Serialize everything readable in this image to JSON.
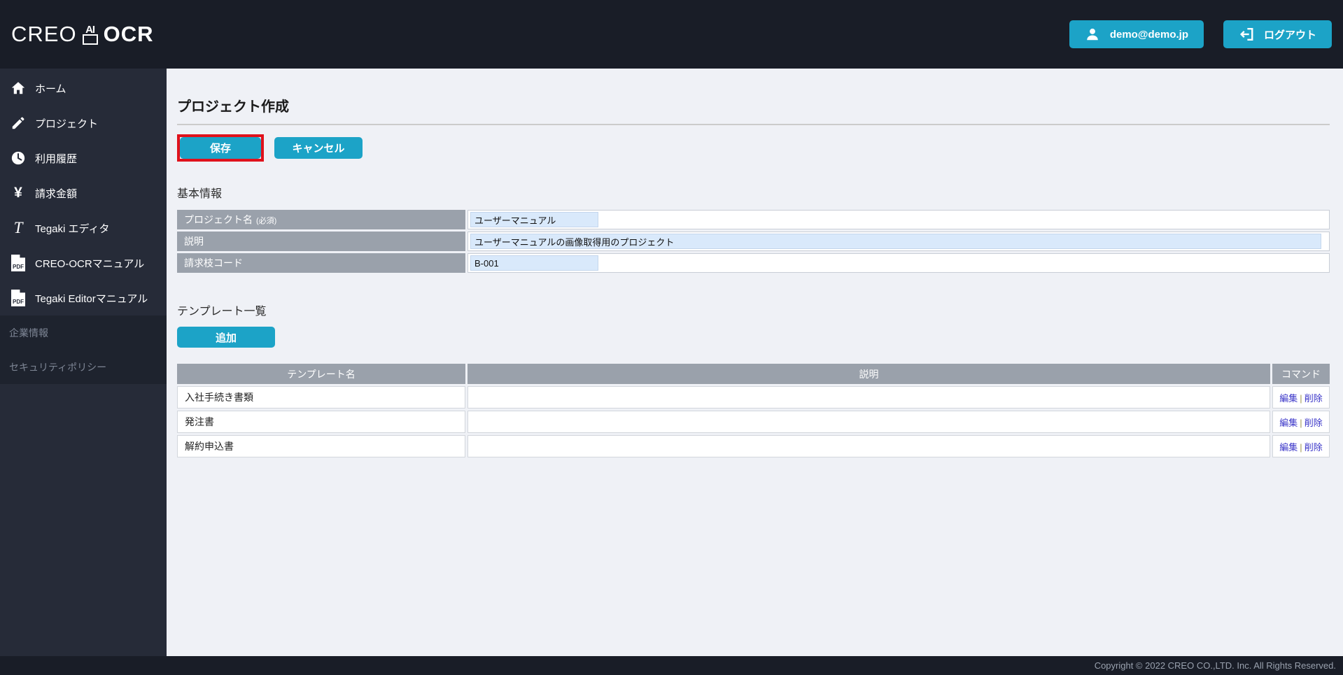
{
  "header": {
    "logo_part1": "CREO",
    "logo_mark_text": "AI",
    "logo_part2": "OCR",
    "user_button_label": "demo@demo.jp",
    "logout_button_label": "ログアウト"
  },
  "sidebar": {
    "items": [
      {
        "label": "ホーム",
        "icon": "home-icon"
      },
      {
        "label": "プロジェクト",
        "icon": "pencil-icon"
      },
      {
        "label": "利用履歴",
        "icon": "clock-icon"
      },
      {
        "label": "請求金額",
        "icon": "yen-icon"
      },
      {
        "label": "Tegaki エディタ",
        "icon": "tegaki-icon"
      },
      {
        "label": "CREO-OCRマニュアル",
        "icon": "pdf-icon"
      },
      {
        "label": "Tegaki Editorマニュアル",
        "icon": "pdf-icon"
      }
    ],
    "secondary_items": [
      {
        "label": "企業情報"
      },
      {
        "label": "セキュリティポリシー"
      }
    ]
  },
  "main": {
    "page_title": "プロジェクト作成",
    "save_button": "保存",
    "cancel_button": "キャンセル",
    "basic_info": {
      "heading": "基本情報",
      "rows": [
        {
          "label": "プロジェクト名",
          "note": "(必須)",
          "value": "ユーザーマニュアル"
        },
        {
          "label": "説明",
          "note": "",
          "value": "ユーザーマニュアルの画像取得用のプロジェクト"
        },
        {
          "label": "請求枝コード",
          "note": "",
          "value": "B-001"
        }
      ]
    },
    "template_list": {
      "heading": "テンプレート一覧",
      "add_button": "追加",
      "columns": [
        "テンプレート名",
        "説明",
        "コマンド"
      ],
      "rows": [
        {
          "name": "入社手続き書類",
          "description": ""
        },
        {
          "name": "発注書",
          "description": ""
        },
        {
          "name": "解約申込書",
          "description": ""
        }
      ],
      "edit_label": "編集",
      "delete_label": "削除",
      "separator": "|"
    }
  },
  "footer": {
    "copyright": "Copyright © 2022 CREO CO.,LTD. Inc. All Rights Reserved."
  },
  "colors": {
    "accent_teal": "#1ca3c7",
    "highlight_red": "#e0121c",
    "header_dark": "#191d27",
    "sidebar_dark": "#262b38",
    "table_header_gray": "#9aa1ab",
    "input_blue": "#d9e9fb",
    "link_blue": "#3a35c8"
  }
}
